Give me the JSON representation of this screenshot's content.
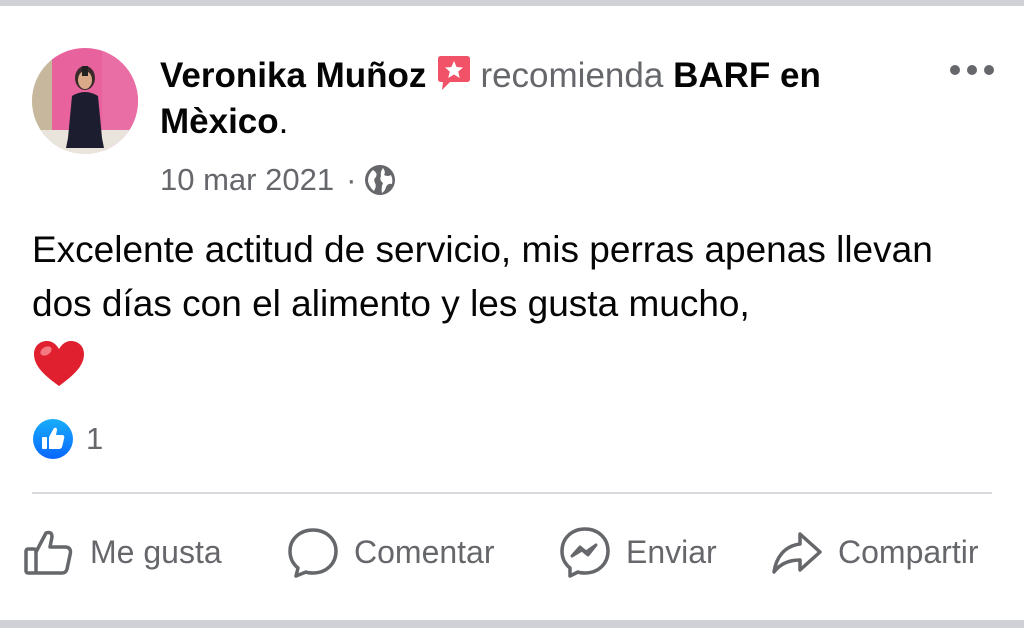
{
  "post": {
    "author": "Veronika Muñoz",
    "action_text": "recomienda",
    "page_name": "BARF en Mèxico",
    "period": ".",
    "date": "10 mar 2021",
    "separator": "·",
    "privacy_icon": "globe-icon",
    "recommend_badge_icon": "recommendation-badge-icon",
    "body_text": "Excelente actitud de servicio, mis perras apenas llevan dos días con el alimento y les gusta mucho,",
    "body_emoji": "heart-emoji"
  },
  "reactions": {
    "icon": "like-reaction-icon",
    "count": "1"
  },
  "actions": [
    {
      "label": "Me gusta",
      "icon": "thumbs-up-icon"
    },
    {
      "label": "Comentar",
      "icon": "comment-bubble-icon"
    },
    {
      "label": "Enviar",
      "icon": "messenger-icon"
    },
    {
      "label": "Compartir",
      "icon": "share-arrow-icon"
    }
  ],
  "colors": {
    "text_primary": "#050505",
    "text_secondary": "#65676b",
    "like_blue": "#1877f2",
    "badge_pink": "#f25268",
    "heart_red": "#e0202e"
  }
}
